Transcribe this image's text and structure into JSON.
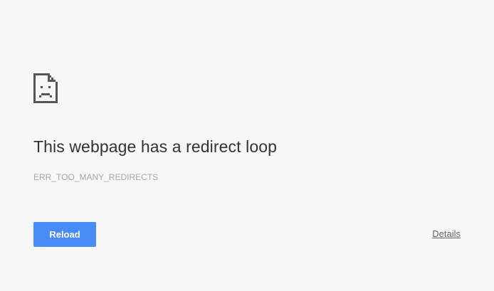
{
  "error": {
    "icon": "sad-page-icon",
    "title": "This webpage has a redirect loop",
    "code": "ERR_TOO_MANY_REDIRECTS"
  },
  "actions": {
    "reload_label": "Reload",
    "details_label": "Details"
  },
  "colors": {
    "background": "#f7f7f7",
    "button": "#4a8cf7",
    "title": "#333333",
    "code": "#a6a6a6",
    "icon": "#555555"
  }
}
